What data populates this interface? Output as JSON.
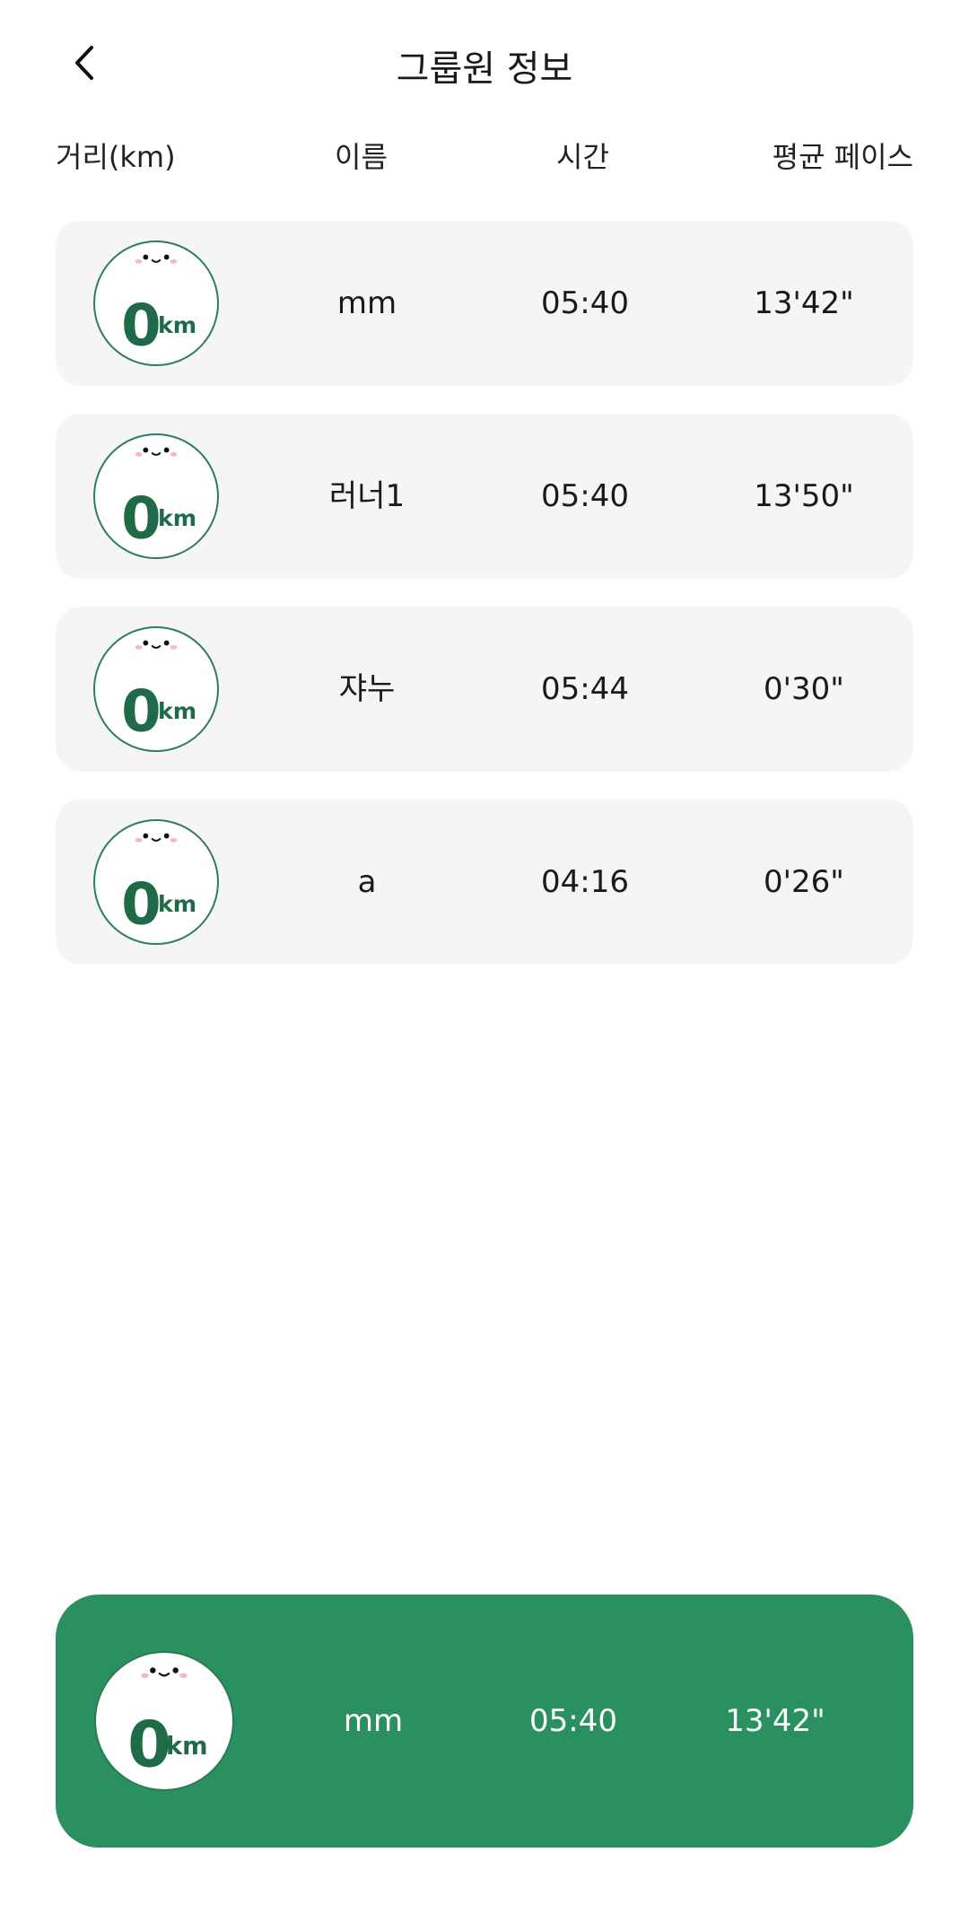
{
  "header": {
    "title": "그룹원 정보",
    "back_icon": "chevron-left-icon"
  },
  "columns": {
    "distance": "거리(km)",
    "name": "이름",
    "time": "시간",
    "pace": "평균 페이스"
  },
  "members": [
    {
      "distance": "0",
      "unit": "km",
      "name": "mm",
      "time": "05:40",
      "pace": "13'42\""
    },
    {
      "distance": "0",
      "unit": "km",
      "name": "러너1",
      "time": "05:40",
      "pace": "13'50\""
    },
    {
      "distance": "0",
      "unit": "km",
      "name": "쟈누",
      "time": "05:44",
      "pace": "0'30\""
    },
    {
      "distance": "0",
      "unit": "km",
      "name": "a",
      "time": "04:16",
      "pace": "0'26\""
    }
  ],
  "my_record": {
    "distance": "0",
    "unit": "km",
    "name": "mm",
    "time": "05:40",
    "pace": "13'42\""
  },
  "colors": {
    "accent": "#2b9060",
    "row_bg": "#f5f5f5",
    "badge_green": "#1f6b47",
    "cheek": "#f7b8c2"
  }
}
